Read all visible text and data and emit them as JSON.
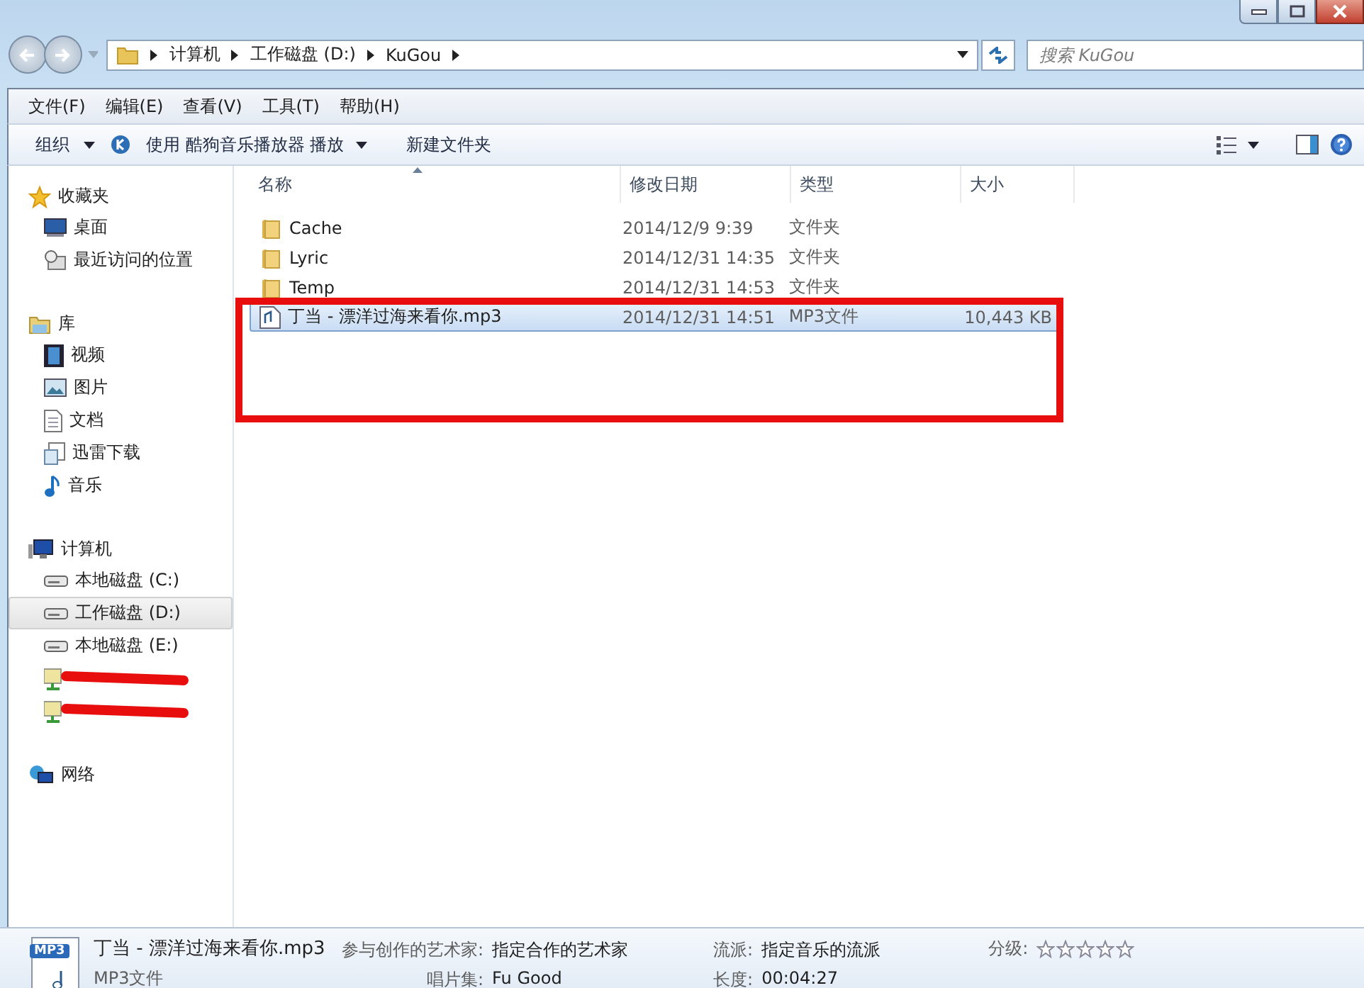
{
  "address_bar": {
    "breadcrumbs": [
      "计算机",
      "工作磁盘 (D:)",
      "KuGou"
    ]
  },
  "search": {
    "placeholder": "搜索 KuGou"
  },
  "menu_bar": [
    "文件(F)",
    "编辑(E)",
    "查看(V)",
    "工具(T)",
    "帮助(H)"
  ],
  "toolbar": {
    "organize": "组织",
    "play": "使用 酷狗音乐播放器 播放",
    "new_folder": "新建文件夹"
  },
  "sidebar": {
    "groups": [
      {
        "label": "收藏夹",
        "items": [
          {
            "label": "桌面",
            "selected": false
          },
          {
            "label": "最近访问的位置",
            "selected": false
          }
        ]
      },
      {
        "label": "库",
        "items": [
          {
            "label": "视频",
            "selected": false
          },
          {
            "label": "图片",
            "selected": false
          },
          {
            "label": "文档",
            "selected": false
          },
          {
            "label": "迅雷下载",
            "selected": false
          },
          {
            "label": "音乐",
            "selected": false
          }
        ]
      },
      {
        "label": "计算机",
        "items": [
          {
            "label": "本地磁盘 (C:)",
            "selected": false
          },
          {
            "label": "工作磁盘 (D:)",
            "selected": true
          },
          {
            "label": "本地磁盘 (E:)",
            "selected": false
          },
          {
            "selected": false
          },
          {
            "selected": false
          }
        ]
      },
      {
        "label": "网络"
      }
    ]
  },
  "table": {
    "columns": [
      "名称",
      "修改日期",
      "类型",
      "大小"
    ],
    "rows": [
      {
        "kind": "folder",
        "name": "Cache",
        "date": "2014/12/9 9:39",
        "type": "文件夹",
        "size": "",
        "selected": false
      },
      {
        "kind": "folder",
        "name": "Lyric",
        "date": "2014/12/31 14:35",
        "type": "文件夹",
        "size": "",
        "selected": false
      },
      {
        "kind": "folder",
        "name": "Temp",
        "date": "2014/12/31 14:53",
        "type": "文件夹",
        "size": "",
        "selected": false
      },
      {
        "kind": "file",
        "name": "丁当 - 漂洋过海来看你.mp3",
        "date": "2014/12/31 14:51",
        "type": "MP3文件",
        "size": "10,443 KB",
        "selected": true
      }
    ]
  },
  "details": {
    "icon_label": "MP3",
    "title": "丁当 - 漂洋过海来看你.mp3",
    "file_type": "MP3文件",
    "fields": [
      {
        "label": "参与创作的艺术家:",
        "value": "指定合作的艺术家"
      },
      {
        "label": "唱片集:",
        "value": "Fu Good"
      },
      {
        "label": "流派:",
        "value": "指定音乐的流派"
      },
      {
        "label": "长度:",
        "value": "00:04:27"
      }
    ],
    "rating_label": "分级:",
    "stars": 0
  }
}
